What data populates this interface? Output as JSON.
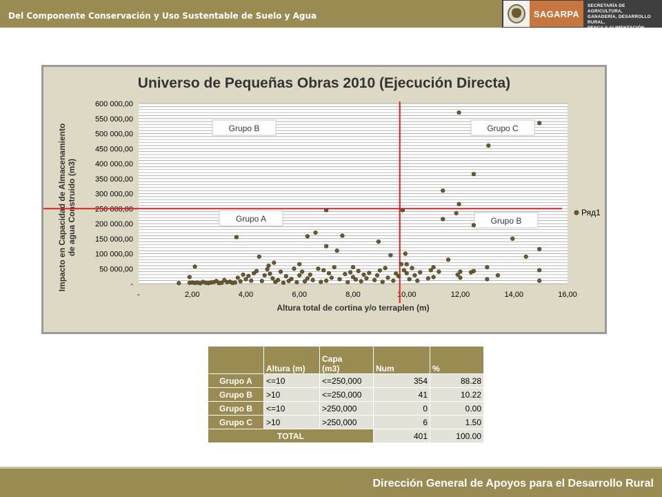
{
  "header": {
    "title": "Del Componente Conservación y Uso Sustentable de Suelo y Agua"
  },
  "logo": {
    "brand": "SAGARPA",
    "lines": [
      "SECRETARÍA DE AGRICULTURA,",
      "GANADERÍA, DESARROLLO RURAL,",
      "PESCA Y ALIMENTACIÓN"
    ]
  },
  "chart_data": {
    "type": "scatter",
    "title": "Universo de Pequeñas Obras 2010 (Ejecución Directa)",
    "xlabel": "Altura total de cortina y/o terraplen (m)",
    "ylabel": "Impacto en Capacidad de Almacenamiento de agua Construido (m3)",
    "xlim": [
      0,
      16
    ],
    "ylim": [
      0,
      600000
    ],
    "x_ticks": [
      0,
      2,
      4,
      6,
      8,
      10,
      12,
      14,
      16
    ],
    "x_tick_labels": [
      "-",
      "2,00",
      "4,00",
      "6,00",
      "8,00",
      "10,00",
      "12,00",
      "14,00",
      "16,00"
    ],
    "y_ticks": [
      0,
      50000,
      100000,
      150000,
      200000,
      250000,
      300000,
      350000,
      400000,
      450000,
      500000,
      550000,
      600000
    ],
    "y_tick_labels": [
      "-",
      "50 000,00",
      "100 000,00",
      "150 000,00",
      "200 000,00",
      "250 000,00",
      "300 000,00",
      "350 000,00",
      "400 000,00",
      "450 000,00",
      "500 000,00",
      "550 000,00",
      "600 000,00"
    ],
    "grid": true,
    "legend": "right",
    "reference_lines": {
      "x": 10,
      "y": 250000
    },
    "quadrant_labels": [
      {
        "text": "Grupo B",
        "quadrant": "top-left"
      },
      {
        "text": "Grupo C",
        "quadrant": "top-right"
      },
      {
        "text": "Grupo A",
        "quadrant": "bottom-left"
      },
      {
        "text": "Grupo B",
        "quadrant": "bottom-right"
      }
    ],
    "series": [
      {
        "name": "Ряд1",
        "color": "#6b5a30",
        "points": [
          [
            1.5,
            2000
          ],
          [
            1.9,
            22000
          ],
          [
            2.1,
            57000
          ],
          [
            1.9,
            3000
          ],
          [
            2.0,
            4000
          ],
          [
            2.1,
            2500
          ],
          [
            2.2,
            3500
          ],
          [
            2.3,
            1500
          ],
          [
            2.4,
            6000
          ],
          [
            2.5,
            3000
          ],
          [
            2.6,
            2000
          ],
          [
            2.7,
            4000
          ],
          [
            2.8,
            5000
          ],
          [
            2.9,
            9000
          ],
          [
            3.0,
            2000
          ],
          [
            3.1,
            3000
          ],
          [
            3.2,
            12000
          ],
          [
            3.3,
            5000
          ],
          [
            3.4,
            7000
          ],
          [
            3.5,
            2500
          ],
          [
            3.6,
            4000
          ],
          [
            3.7,
            20000
          ],
          [
            3.65,
            155000
          ],
          [
            3.8,
            8000
          ],
          [
            3.9,
            30000
          ],
          [
            4.0,
            15000
          ],
          [
            4.1,
            26000
          ],
          [
            4.2,
            10000
          ],
          [
            4.3,
            35000
          ],
          [
            4.4,
            42000
          ],
          [
            4.5,
            90000
          ],
          [
            4.6,
            9000
          ],
          [
            4.7,
            28000
          ],
          [
            4.8,
            48000
          ],
          [
            4.85,
            60000
          ],
          [
            4.9,
            33000
          ],
          [
            5.0,
            18000
          ],
          [
            5.05,
            70000
          ],
          [
            5.1,
            6000
          ],
          [
            5.2,
            12000
          ],
          [
            5.3,
            40000
          ],
          [
            5.4,
            3000
          ],
          [
            5.5,
            25000
          ],
          [
            5.6,
            9000
          ],
          [
            5.7,
            16000
          ],
          [
            5.8,
            50000
          ],
          [
            5.9,
            5000
          ],
          [
            6.0,
            28000
          ],
          [
            6.0,
            65000
          ],
          [
            6.1,
            40000
          ],
          [
            6.2,
            8000
          ],
          [
            6.3,
            18000
          ],
          [
            6.3,
            158000
          ],
          [
            6.4,
            30000
          ],
          [
            6.5,
            12000
          ],
          [
            6.6,
            170000
          ],
          [
            6.7,
            50000
          ],
          [
            6.8,
            6000
          ],
          [
            6.9,
            45000
          ],
          [
            7.0,
            10000
          ],
          [
            7.0,
            125000
          ],
          [
            7.0,
            245000
          ],
          [
            7.1,
            35000
          ],
          [
            7.2,
            20000
          ],
          [
            7.3,
            55000
          ],
          [
            7.4,
            110000
          ],
          [
            7.5,
            15000
          ],
          [
            7.6,
            160000
          ],
          [
            7.7,
            32000
          ],
          [
            7.8,
            5000
          ],
          [
            7.9,
            38000
          ],
          [
            8.0,
            22000
          ],
          [
            8.0,
            55000
          ],
          [
            8.1,
            14000
          ],
          [
            8.2,
            42000
          ],
          [
            8.3,
            8000
          ],
          [
            8.4,
            30000
          ],
          [
            8.5,
            18000
          ],
          [
            8.6,
            36000
          ],
          [
            8.8,
            12000
          ],
          [
            8.9,
            28000
          ],
          [
            8.95,
            140000
          ],
          [
            9.0,
            44000
          ],
          [
            9.1,
            6000
          ],
          [
            9.2,
            52000
          ],
          [
            9.3,
            20000
          ],
          [
            9.4,
            95000
          ],
          [
            9.5,
            10000
          ],
          [
            9.6,
            34000
          ],
          [
            9.7,
            25000
          ],
          [
            9.8,
            65000
          ],
          [
            9.85,
            245000
          ],
          [
            9.9,
            45000
          ],
          [
            9.95,
            100000
          ],
          [
            10.0,
            35000
          ],
          [
            10.0,
            65000
          ],
          [
            10.1,
            15000
          ],
          [
            10.2,
            52000
          ],
          [
            10.3,
            28000
          ],
          [
            10.4,
            10000
          ],
          [
            10.5,
            38000
          ],
          [
            10.8,
            18000
          ],
          [
            10.9,
            45000
          ],
          [
            11.0,
            55000
          ],
          [
            11.0,
            22000
          ],
          [
            11.2,
            40000
          ],
          [
            11.35,
            215000
          ],
          [
            11.35,
            310000
          ],
          [
            11.55,
            80000
          ],
          [
            11.85,
            235000
          ],
          [
            11.95,
            265000
          ],
          [
            11.95,
            570000
          ],
          [
            11.9,
            30000
          ],
          [
            12.0,
            20000
          ],
          [
            12.0,
            40000
          ],
          [
            12.4,
            38000
          ],
          [
            12.5,
            195000
          ],
          [
            12.5,
            365000
          ],
          [
            12.5,
            42000
          ],
          [
            13.0,
            15000
          ],
          [
            13.0,
            55000
          ],
          [
            13.05,
            460000
          ],
          [
            13.4,
            28000
          ],
          [
            13.95,
            150000
          ],
          [
            14.45,
            90000
          ],
          [
            14.95,
            10000
          ],
          [
            14.95,
            45000
          ],
          [
            14.95,
            115000
          ],
          [
            14.95,
            535000
          ]
        ]
      }
    ]
  },
  "table": {
    "headers": [
      "",
      "Altura (m)",
      "Capa\n(m3)",
      "Num",
      "%"
    ],
    "rows": [
      {
        "group": "Grupo A",
        "altura": "<=10",
        "capa": "<=250,000",
        "num": "354",
        "pct": "88.28"
      },
      {
        "group": "Grupo B",
        "altura": ">10",
        "capa": "<=250,000",
        "num": "41",
        "pct": "10.22"
      },
      {
        "group": "Grupo B",
        "altura": "<=10",
        "capa": ">250,000",
        "num": "0",
        "pct": "0.00"
      },
      {
        "group": "Grupo C",
        "altura": ">10",
        "capa": ">250,000",
        "num": "6",
        "pct": "1.50"
      }
    ],
    "total": {
      "label": "TOTAL",
      "num": "401",
      "pct": "100.00"
    }
  },
  "footer": {
    "text": "Dirección General de Apoyos para el Desarrollo Rural"
  }
}
